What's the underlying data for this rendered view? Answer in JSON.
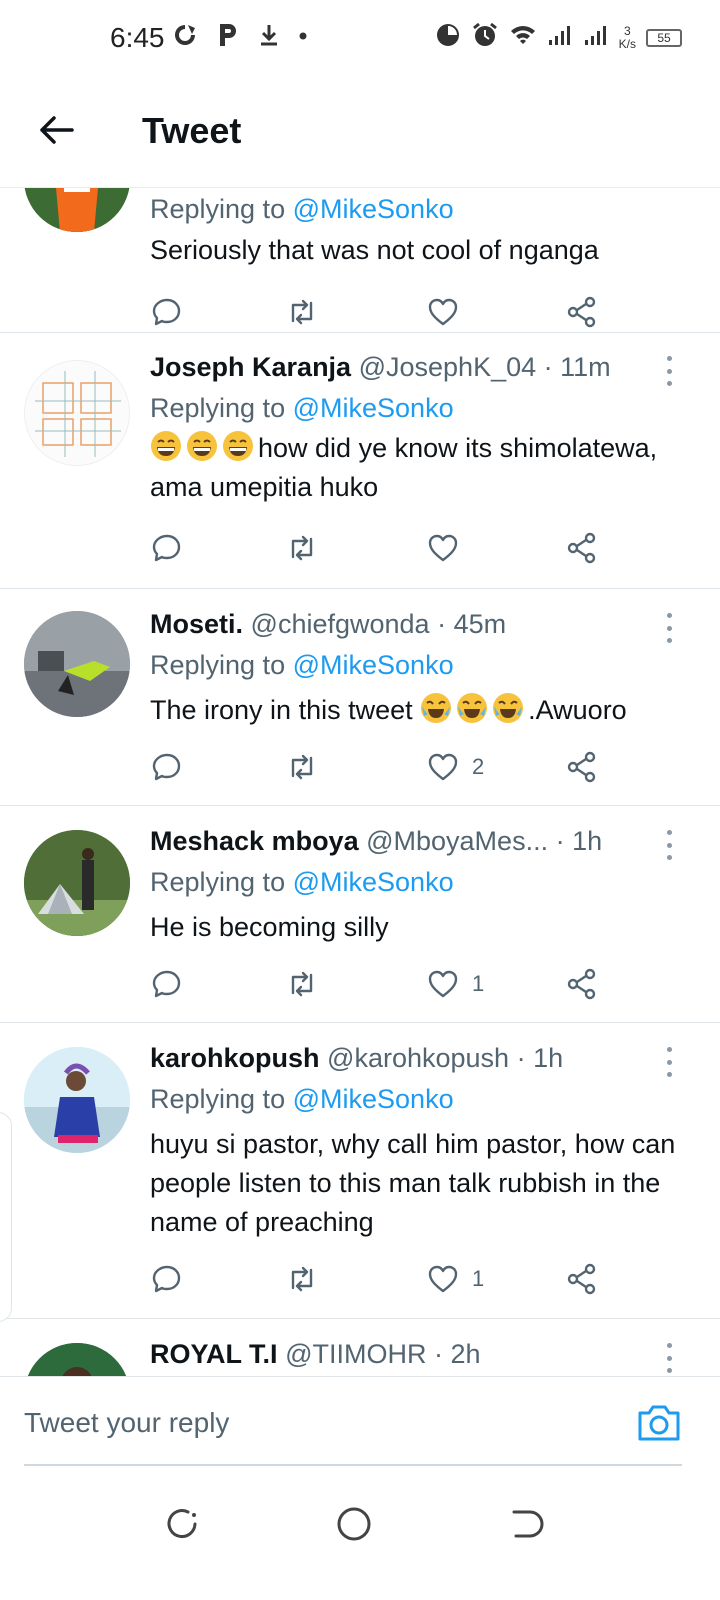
{
  "status_bar": {
    "time": "6:45",
    "network_speed": "3\nK/s",
    "battery": "55",
    "icons_left": [
      "data-saver-icon",
      "p-app-icon",
      "download-icon",
      "dot-icon"
    ],
    "icons_right": [
      "timer-icon",
      "alarm-icon",
      "wifi-icon",
      "signal-icon",
      "signal-icon"
    ]
  },
  "header": {
    "title": "Tweet",
    "back_icon": "arrow-left-icon"
  },
  "tweets": [
    {
      "name": "",
      "handle": "",
      "time": "",
      "replying_prefix": "Replying to",
      "replying_to": "@MikeSonko",
      "text": "Seriously that was not cool of nganga",
      "likes": ""
    },
    {
      "name": "Joseph Karanja",
      "handle": "@JosephK_04",
      "time": "· 11m",
      "replying_prefix": "Replying to",
      "replying_to": "@MikeSonko",
      "emoji_prefix": [
        "grinning-face",
        "grinning-face",
        "grinning-face"
      ],
      "text": "how did ye know its shimolatewa, ama umepitia huko",
      "likes": ""
    },
    {
      "name": "Moseti.",
      "handle": "@chiefgwonda",
      "time": "· 45m",
      "replying_prefix": "Replying to",
      "replying_to": "@MikeSonko",
      "text_before": "The irony in this tweet",
      "emoji_inline": [
        "tears-of-joy",
        "tears-of-joy",
        "tears-of-joy"
      ],
      "text_after": ".Awuoro",
      "likes": "2"
    },
    {
      "name": "Meshack mboya",
      "handle": "@MboyaMes...",
      "time": "· 1h",
      "replying_prefix": "Replying to",
      "replying_to": "@MikeSonko",
      "text": "He is becoming silly",
      "likes": "1"
    },
    {
      "name": "karohkopush",
      "handle": "@karohkopush",
      "time": "· 1h",
      "replying_prefix": "Replying to",
      "replying_to": "@MikeSonko",
      "text": "huyu si pastor, why call him pastor, how can people listen to this man talk rubbish in the name of preaching",
      "likes": "1"
    },
    {
      "name": "ROYAL T.I",
      "handle": "@TIIMOHR",
      "time": "· 2h",
      "replying_prefix": "",
      "replying_to": "",
      "text": "",
      "likes": ""
    }
  ],
  "reply_bar": {
    "placeholder": "Tweet your reply",
    "camera_icon": "camera-icon"
  },
  "nav": {
    "icons": [
      "recents-icon",
      "home-circle-icon",
      "back-nav-icon"
    ]
  },
  "colors": {
    "link": "#1d9bf0",
    "muted": "#536471",
    "text": "#0f1419",
    "divider": "#dfe5e9"
  }
}
